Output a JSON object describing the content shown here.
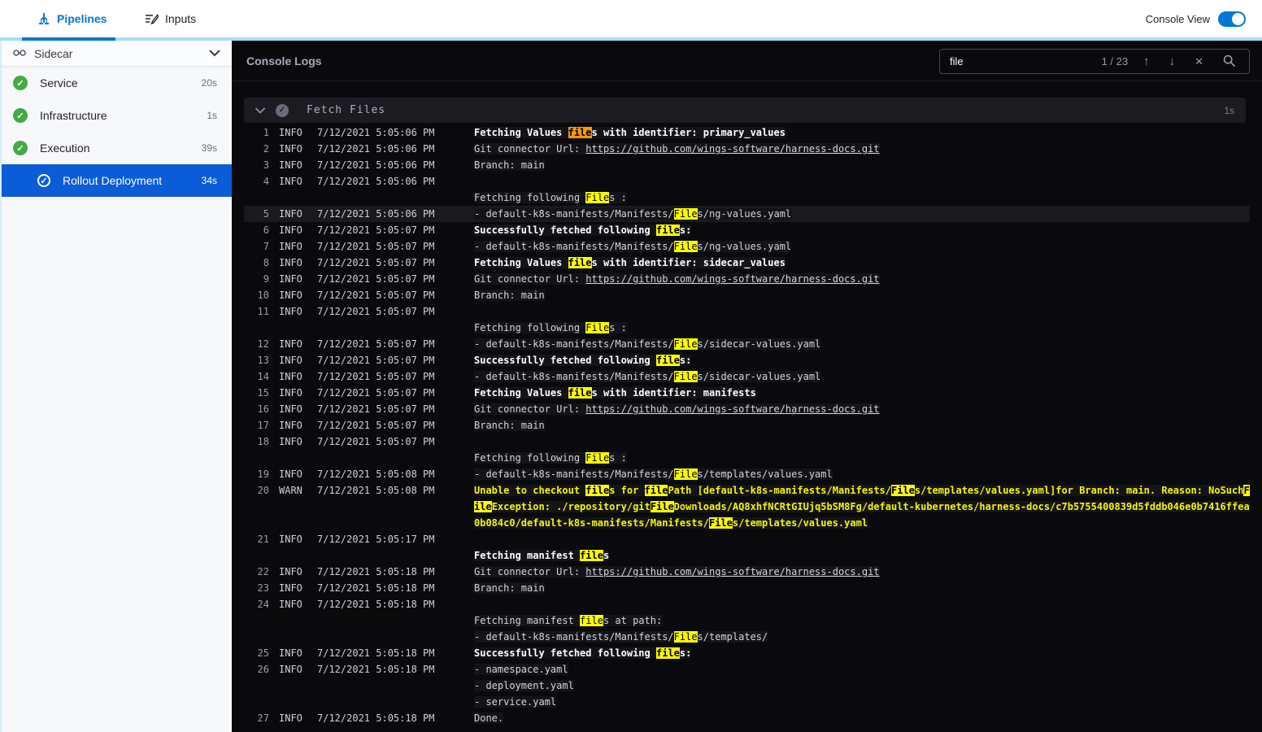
{
  "colors": {
    "accent": "#0278d5",
    "selected_row": "#0b5cd7",
    "success_green": "#42ab45",
    "match_highlight": "#fcfc00",
    "current_match": "#ff9800",
    "warn_text": "#f5f500"
  },
  "header": {
    "tabs": [
      {
        "label": "Pipelines",
        "active": true
      },
      {
        "label": "Inputs",
        "active": false
      }
    ],
    "console_view_label": "Console View",
    "console_view_on": true
  },
  "sidebar": {
    "title": "Sidecar",
    "items": [
      {
        "label": "Service",
        "duration": "20s",
        "status": "success",
        "selected": false,
        "indent": false
      },
      {
        "label": "Infrastructure",
        "duration": "1s",
        "status": "success",
        "selected": false,
        "indent": false
      },
      {
        "label": "Execution",
        "duration": "39s",
        "status": "success",
        "selected": false,
        "indent": false
      },
      {
        "label": "Rollout Deployment",
        "duration": "34s",
        "status": "success",
        "selected": true,
        "indent": true
      }
    ]
  },
  "console": {
    "title": "Console Logs",
    "search": {
      "value": "file",
      "counter": "1 / 23"
    },
    "section": {
      "title": "Fetch Files",
      "duration": "1s"
    }
  },
  "log": {
    "lines": [
      {
        "n": 1,
        "lv": "INFO",
        "t": "7/12/2021 5:05:06 PM",
        "rows": [
          {
            "b": true,
            "s": [
              {
                "x": "Fetching Values "
              },
              {
                "x": "file",
                "m": "o"
              },
              {
                "x": "s with identifier: primary_values"
              }
            ]
          }
        ]
      },
      {
        "n": 2,
        "lv": "INFO",
        "t": "7/12/2021 5:05:06 PM",
        "rows": [
          {
            "s": [
              {
                "x": "Git connector Url: "
              },
              {
                "x": "https://github.com/wings-software/harness-docs.git",
                "link": true
              }
            ]
          }
        ]
      },
      {
        "n": 3,
        "lv": "INFO",
        "t": "7/12/2021 5:05:06 PM",
        "rows": [
          {
            "s": [
              {
                "x": "Branch: main"
              }
            ]
          }
        ]
      },
      {
        "n": 4,
        "lv": "INFO",
        "t": "7/12/2021 5:05:06 PM",
        "rows": [
          {
            "s": []
          },
          {
            "s": [
              {
                "x": "Fetching following "
              },
              {
                "x": "File",
                "m": "y"
              },
              {
                "x": "s :"
              }
            ]
          }
        ]
      },
      {
        "n": 5,
        "lv": "INFO",
        "t": "7/12/2021 5:05:06 PM",
        "hl": true,
        "rows": [
          {
            "s": [
              {
                "x": "- default-k8s-manifests/Manifests/"
              },
              {
                "x": "File",
                "m": "y"
              },
              {
                "x": "s/ng-values.yaml"
              }
            ]
          }
        ]
      },
      {
        "n": 6,
        "lv": "INFO",
        "t": "7/12/2021 5:05:07 PM",
        "rows": [
          {
            "b": true,
            "s": [
              {
                "x": "Successfully fetched following "
              },
              {
                "x": "file",
                "m": "y"
              },
              {
                "x": "s:"
              }
            ]
          }
        ]
      },
      {
        "n": 7,
        "lv": "INFO",
        "t": "7/12/2021 5:05:07 PM",
        "rows": [
          {
            "s": [
              {
                "x": "- default-k8s-manifests/Manifests/"
              },
              {
                "x": "File",
                "m": "y"
              },
              {
                "x": "s/ng-values.yaml"
              }
            ]
          }
        ]
      },
      {
        "n": 8,
        "lv": "INFO",
        "t": "7/12/2021 5:05:07 PM",
        "rows": [
          {
            "b": true,
            "s": [
              {
                "x": "Fetching Values "
              },
              {
                "x": "file",
                "m": "y"
              },
              {
                "x": "s with identifier: sidecar_values"
              }
            ]
          }
        ]
      },
      {
        "n": 9,
        "lv": "INFO",
        "t": "7/12/2021 5:05:07 PM",
        "rows": [
          {
            "s": [
              {
                "x": "Git connector Url: "
              },
              {
                "x": "https://github.com/wings-software/harness-docs.git",
                "link": true
              }
            ]
          }
        ]
      },
      {
        "n": 10,
        "lv": "INFO",
        "t": "7/12/2021 5:05:07 PM",
        "rows": [
          {
            "s": [
              {
                "x": "Branch: main"
              }
            ]
          }
        ]
      },
      {
        "n": 11,
        "lv": "INFO",
        "t": "7/12/2021 5:05:07 PM",
        "rows": [
          {
            "s": []
          },
          {
            "s": [
              {
                "x": "Fetching following "
              },
              {
                "x": "File",
                "m": "y"
              },
              {
                "x": "s :"
              }
            ]
          }
        ]
      },
      {
        "n": 12,
        "lv": "INFO",
        "t": "7/12/2021 5:05:07 PM",
        "rows": [
          {
            "s": [
              {
                "x": "- default-k8s-manifests/Manifests/"
              },
              {
                "x": "File",
                "m": "y"
              },
              {
                "x": "s/sidecar-values.yaml"
              }
            ]
          }
        ]
      },
      {
        "n": 13,
        "lv": "INFO",
        "t": "7/12/2021 5:05:07 PM",
        "rows": [
          {
            "b": true,
            "s": [
              {
                "x": "Successfully fetched following "
              },
              {
                "x": "file",
                "m": "y"
              },
              {
                "x": "s:"
              }
            ]
          }
        ]
      },
      {
        "n": 14,
        "lv": "INFO",
        "t": "7/12/2021 5:05:07 PM",
        "rows": [
          {
            "s": [
              {
                "x": "- default-k8s-manifests/Manifests/"
              },
              {
                "x": "File",
                "m": "y"
              },
              {
                "x": "s/sidecar-values.yaml"
              }
            ]
          }
        ]
      },
      {
        "n": 15,
        "lv": "INFO",
        "t": "7/12/2021 5:05:07 PM",
        "rows": [
          {
            "b": true,
            "s": [
              {
                "x": "Fetching Values "
              },
              {
                "x": "file",
                "m": "y"
              },
              {
                "x": "s with identifier: manifests"
              }
            ]
          }
        ]
      },
      {
        "n": 16,
        "lv": "INFO",
        "t": "7/12/2021 5:05:07 PM",
        "rows": [
          {
            "s": [
              {
                "x": "Git connector Url: "
              },
              {
                "x": "https://github.com/wings-software/harness-docs.git",
                "link": true
              }
            ]
          }
        ]
      },
      {
        "n": 17,
        "lv": "INFO",
        "t": "7/12/2021 5:05:07 PM",
        "rows": [
          {
            "s": [
              {
                "x": "Branch: main"
              }
            ]
          }
        ]
      },
      {
        "n": 18,
        "lv": "INFO",
        "t": "7/12/2021 5:05:07 PM",
        "rows": [
          {
            "s": []
          },
          {
            "s": [
              {
                "x": "Fetching following "
              },
              {
                "x": "File",
                "m": "y"
              },
              {
                "x": "s :"
              }
            ]
          }
        ]
      },
      {
        "n": 19,
        "lv": "INFO",
        "t": "7/12/2021 5:05:08 PM",
        "rows": [
          {
            "s": [
              {
                "x": "- default-k8s-manifests/Manifests/"
              },
              {
                "x": "File",
                "m": "y"
              },
              {
                "x": "s/templates/values.yaml"
              }
            ]
          }
        ]
      },
      {
        "n": 20,
        "lv": "WARN",
        "t": "7/12/2021 5:05:08 PM",
        "rows": [
          {
            "s": [
              {
                "x": "Unable to checkout "
              },
              {
                "x": "file",
                "m": "y"
              },
              {
                "x": "s for "
              },
              {
                "x": "file",
                "m": "y"
              },
              {
                "x": "Path [default-k8s-manifests/Manifests/"
              },
              {
                "x": "File",
                "m": "y"
              },
              {
                "x": "s/templates/values.yaml]for Branch: main. Reason: NoSuch"
              },
              {
                "x": "F",
                "m": "y"
              }
            ]
          },
          {
            "s": [
              {
                "x": "ile",
                "m": "y"
              },
              {
                "x": "Exception: ./repository/git"
              },
              {
                "x": "File",
                "m": "y"
              },
              {
                "x": "Downloads/AQ8xhfNCRtGIUjq5bSM8Fg/default-kubernetes/harness-docs/c7b5755400839d5fddb046e0b7416ffea"
              }
            ]
          },
          {
            "s": [
              {
                "x": "0b084c0/default-k8s-manifests/Manifests/"
              },
              {
                "x": "File",
                "m": "y"
              },
              {
                "x": "s/templates/values.yaml"
              }
            ]
          }
        ]
      },
      {
        "n": 21,
        "lv": "INFO",
        "t": "7/12/2021 5:05:17 PM",
        "rows": [
          {
            "s": []
          },
          {
            "b": true,
            "s": [
              {
                "x": "Fetching manifest "
              },
              {
                "x": "file",
                "m": "y"
              },
              {
                "x": "s"
              }
            ]
          }
        ]
      },
      {
        "n": 22,
        "lv": "INFO",
        "t": "7/12/2021 5:05:18 PM",
        "rows": [
          {
            "s": [
              {
                "x": "Git connector Url: "
              },
              {
                "x": "https://github.com/wings-software/harness-docs.git",
                "link": true
              }
            ]
          }
        ]
      },
      {
        "n": 23,
        "lv": "INFO",
        "t": "7/12/2021 5:05:18 PM",
        "rows": [
          {
            "s": [
              {
                "x": "Branch: main"
              }
            ]
          }
        ]
      },
      {
        "n": 24,
        "lv": "INFO",
        "t": "7/12/2021 5:05:18 PM",
        "rows": [
          {
            "s": []
          },
          {
            "s": [
              {
                "x": "Fetching manifest "
              },
              {
                "x": "file",
                "m": "y"
              },
              {
                "x": "s at path:"
              }
            ]
          },
          {
            "s": [
              {
                "x": "- default-k8s-manifests/Manifests/"
              },
              {
                "x": "File",
                "m": "y"
              },
              {
                "x": "s/templates/"
              }
            ]
          }
        ]
      },
      {
        "n": 25,
        "lv": "INFO",
        "t": "7/12/2021 5:05:18 PM",
        "rows": [
          {
            "b": true,
            "s": [
              {
                "x": "Successfully fetched following "
              },
              {
                "x": "file",
                "m": "y"
              },
              {
                "x": "s:"
              }
            ]
          }
        ]
      },
      {
        "n": 26,
        "lv": "INFO",
        "t": "7/12/2021 5:05:18 PM",
        "rows": [
          {
            "s": [
              {
                "x": "- namespace.yaml"
              }
            ]
          },
          {
            "s": [
              {
                "x": "- deployment.yaml"
              }
            ]
          },
          {
            "s": [
              {
                "x": "- service.yaml"
              }
            ]
          }
        ]
      },
      {
        "n": 27,
        "lv": "INFO",
        "t": "7/12/2021 5:05:18 PM",
        "rows": [
          {
            "s": [
              {
                "x": "Done."
              }
            ]
          }
        ]
      }
    ]
  }
}
